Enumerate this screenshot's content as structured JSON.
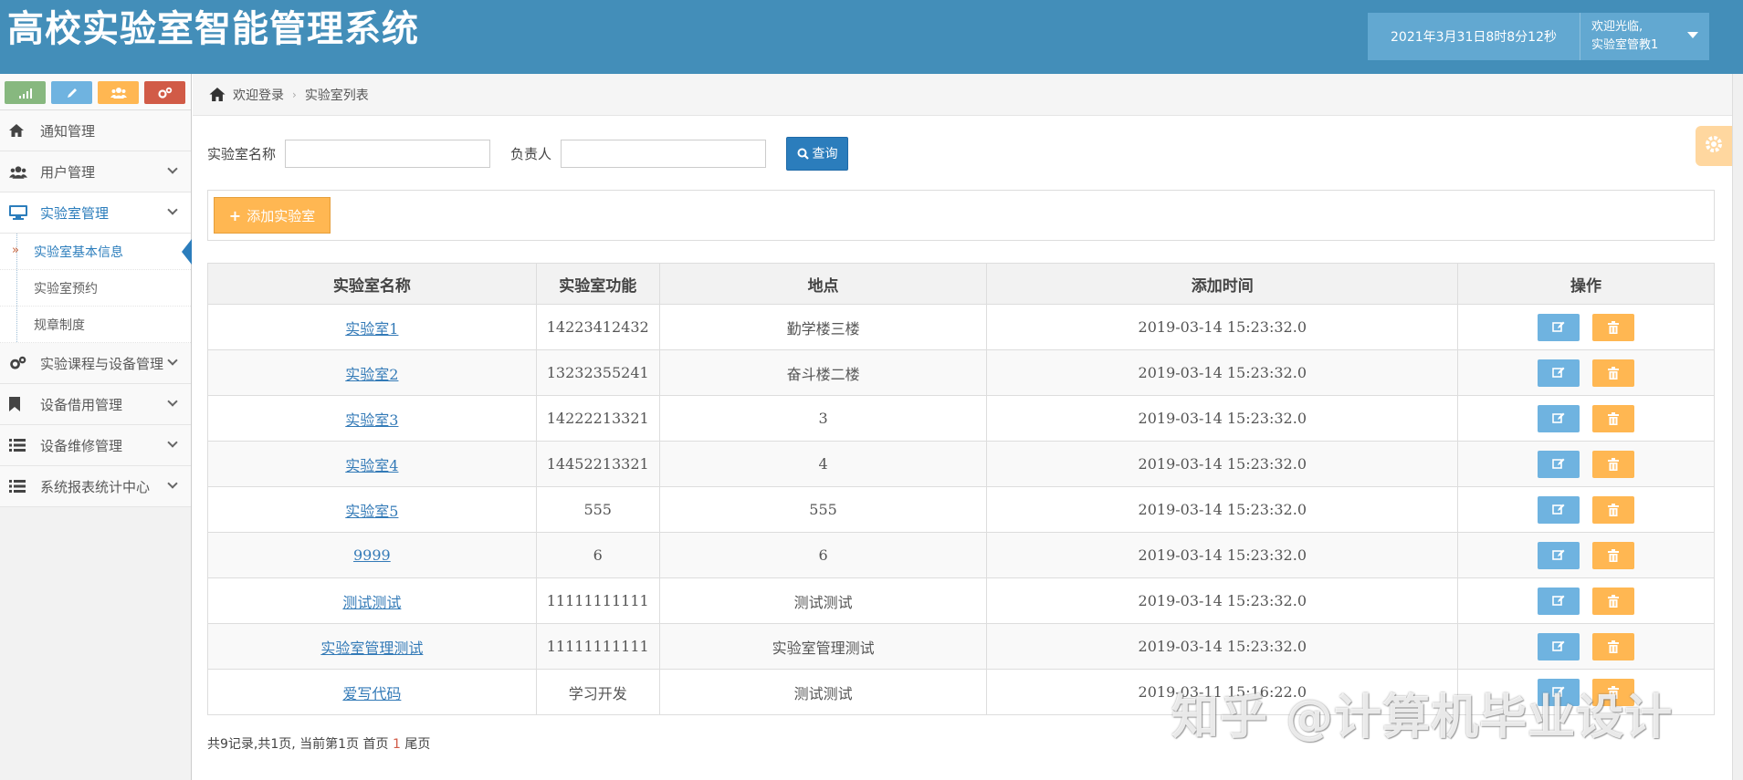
{
  "header": {
    "app_title": "高校实验室智能管理系统",
    "datetime": "2021年3月31日8时8分12秒",
    "welcome": "欢迎光临,",
    "user_name": "实验室管教1"
  },
  "sidebar": {
    "shortcut_icons": [
      "signal-icon",
      "pencil-icon",
      "users-icon",
      "cogs-icon"
    ],
    "items": [
      {
        "label": "通知管理",
        "icon": "home-icon"
      },
      {
        "label": "用户管理",
        "icon": "users-icon"
      },
      {
        "label": "实验室管理",
        "icon": "desktop-icon",
        "open": true,
        "children": [
          {
            "label": "实验室基本信息",
            "active": true
          },
          {
            "label": "实验室预约"
          },
          {
            "label": "规章制度"
          }
        ]
      },
      {
        "label": "实验课程与设备管理",
        "icon": "cogs-icon"
      },
      {
        "label": "设备借用管理",
        "icon": "bookmark-icon"
      },
      {
        "label": "设备维修管理",
        "icon": "list-icon"
      },
      {
        "label": "系统报表统计中心",
        "icon": "list-icon"
      }
    ]
  },
  "breadcrumb": {
    "home": "欢迎登录",
    "current": "实验室列表"
  },
  "search": {
    "name_label": "实验室名称",
    "name_value": "",
    "owner_label": "负责人",
    "owner_value": "",
    "button": "查询"
  },
  "add_button": "添加实验室",
  "table": {
    "headers": [
      "实验室名称",
      "实验室功能",
      "地点",
      "添加时间",
      "操作"
    ],
    "rows": [
      {
        "name": "实验室1",
        "func": "14223412432",
        "place": "勤学楼三楼",
        "time": "2019-03-14 15:23:32.0"
      },
      {
        "name": "实验室2",
        "func": "13232355241",
        "place": "奋斗楼二楼",
        "time": "2019-03-14 15:23:32.0"
      },
      {
        "name": "实验室3",
        "func": "14222213321",
        "place": "3",
        "time": "2019-03-14 15:23:32.0"
      },
      {
        "name": "实验室4",
        "func": "14452213321",
        "place": "4",
        "time": "2019-03-14 15:23:32.0"
      },
      {
        "name": "实验室5",
        "func": "555",
        "place": "555",
        "time": "2019-03-14 15:23:32.0"
      },
      {
        "name": "9999",
        "func": "6",
        "place": "6",
        "time": "2019-03-14 15:23:32.0"
      },
      {
        "name": "测试测试",
        "func": "11111111111",
        "place": "测试测试",
        "time": "2019-03-14 15:23:32.0"
      },
      {
        "name": "实验室管理测试",
        "func": "11111111111",
        "place": "实验室管理测试",
        "time": "2019-03-14 15:23:32.0"
      },
      {
        "name": "爱写代码",
        "func": "学习开发",
        "place": "测试测试",
        "time": "2019-03-11 15:16:22.0"
      }
    ]
  },
  "pager": {
    "summary": "共9记录,共1页, 当前第1页",
    "first": "首页",
    "page": "1",
    "last": "尾页"
  },
  "watermark": "知乎 @计算机毕业设计",
  "colors": {
    "header": "#438eb9",
    "primary": "#2b7dbc",
    "warning": "#ffb752",
    "info": "#6fb3e0"
  }
}
